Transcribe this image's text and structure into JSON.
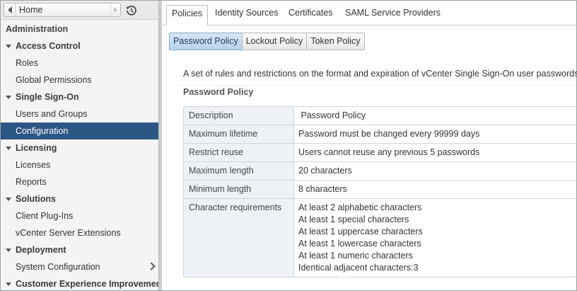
{
  "nav": {
    "home_label": "Home",
    "section_title": "Administration",
    "rows": [
      {
        "label": "Access Control",
        "kind": "group"
      },
      {
        "label": "Roles",
        "kind": "item"
      },
      {
        "label": "Global Permissions",
        "kind": "item"
      },
      {
        "label": "Single Sign-On",
        "kind": "group"
      },
      {
        "label": "Users and Groups",
        "kind": "item"
      },
      {
        "label": "Configuration",
        "kind": "item",
        "selected": true
      },
      {
        "label": "Licensing",
        "kind": "group"
      },
      {
        "label": "Licenses",
        "kind": "item"
      },
      {
        "label": "Reports",
        "kind": "item"
      },
      {
        "label": "Solutions",
        "kind": "group"
      },
      {
        "label": "Client Plug-Ins",
        "kind": "item"
      },
      {
        "label": "vCenter Server Extensions",
        "kind": "item"
      },
      {
        "label": "Deployment",
        "kind": "group"
      },
      {
        "label": "System Configuration",
        "kind": "item",
        "chevron": true
      },
      {
        "label": "Customer Experience Improvement P",
        "kind": "group"
      }
    ],
    "selected_color": "#2c5784"
  },
  "tabs": [
    "Policies",
    "Identity Sources",
    "Certificates",
    "SAML Service Providers"
  ],
  "subtabs": [
    "Password Policy",
    "Lockout Policy",
    "Token Policy"
  ],
  "description": "A set of rules and restrictions on the format and expiration of vCenter Single Sign-On user passwords",
  "policy_title": "Password Policy",
  "policy_rows": [
    {
      "key": "Description",
      "values": [
        " Password Policy"
      ]
    },
    {
      "key": "Maximum lifetime",
      "values": [
        "Password must be changed every 99999 days"
      ]
    },
    {
      "key": "Restrict reuse",
      "values": [
        "Users cannot reuse any previous 5 passwords"
      ]
    },
    {
      "key": "Maximum length",
      "values": [
        "20 characters"
      ]
    },
    {
      "key": "Minimum length",
      "values": [
        "8 characters"
      ]
    },
    {
      "key": "Character requirements",
      "values": [
        "At least 2 alphabetic characters",
        "At least 1 special characters",
        "At least 1 uppercase characters",
        "At least 1 lowercase characters",
        "At least 1 numeric characters",
        "Identical adjacent characters:3"
      ]
    }
  ]
}
